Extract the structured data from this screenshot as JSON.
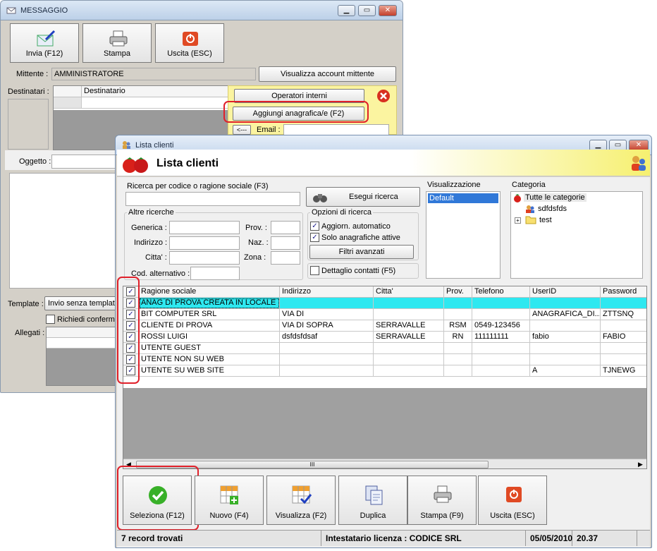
{
  "messaggio": {
    "title": "MESSAGGIO",
    "toolbar": {
      "send": "Invia (F12)",
      "print": "Stampa",
      "exit": "Uscita (ESC)"
    },
    "mittente_label": "Mittente :",
    "mittente_value": "AMMINISTRATORE",
    "view_account": "Visualizza account mittente",
    "destinatari_label": "Destinatari :",
    "destinatario_col": "Destinatario",
    "operatori_interni": "Operatori interni",
    "aggiungi_anagrafica": "Aggiungi anagrafica/e (F2)",
    "arrow_btn": "<---",
    "email_label": "Email :",
    "oggetto_label": "Oggetto :",
    "template_label": "Template :",
    "template_value": "Invio senza template",
    "richiedi_label": "Richiedi conferma",
    "allegati_label": "Allegati :"
  },
  "lista": {
    "title": "Lista clienti",
    "header": "Lista clienti",
    "search_label": "Ricerca per codice o ragione sociale (F3)",
    "search_button": "Esegui ricerca",
    "altre_ricerche": "Altre ricerche",
    "generica": "Generica :",
    "indirizzo": "Indirizzo :",
    "citta": "Citta' :",
    "cod_alt": "Cod. alternativo :",
    "prov": "Prov. :",
    "naz": "Naz. :",
    "zona": "Zona :",
    "opzioni": "Opzioni di ricerca",
    "aggiorn": "Aggiorn. automatico",
    "solo_attive": "Solo anagrafiche attive",
    "filtri": "Filtri avanzati",
    "dettaglio": "Dettaglio contatti (F5)",
    "visualizzazione": "Visualizzazione",
    "vis_default": "Default",
    "categoria": "Categoria",
    "categories": [
      "Tutte le categorie",
      "sdfdsfds",
      "test"
    ],
    "columns": [
      "Ragione sociale",
      "Indirizzo",
      "Citta'",
      "Prov.",
      "Telefono",
      "UserID",
      "Password"
    ],
    "rows": [
      [
        "ANAG DI PROVA CREATA IN LOCALE",
        "",
        "",
        "",
        "",
        "",
        ""
      ],
      [
        "BIT COMPUTER SRL",
        "VIA DI",
        "",
        "",
        "",
        "ANAGRAFICA_DI...",
        "ZTTSNQ"
      ],
      [
        "CLIENTE DI PROVA",
        "VIA DI SOPRA",
        "SERRAVALLE",
        "RSM",
        "0549-123456",
        "",
        ""
      ],
      [
        "ROSSI LUIGI",
        "dsfdsfdsaf",
        "SERRAVALLE",
        "RN",
        "111111111",
        "fabio",
        "FABIO"
      ],
      [
        "UTENTE GUEST",
        "",
        "",
        "",
        "",
        "",
        ""
      ],
      [
        "UTENTE NON SU WEB",
        "",
        "",
        "",
        "",
        "",
        ""
      ],
      [
        "UTENTE SU WEB SITE",
        "",
        "",
        "",
        "",
        "A",
        "TJNEWG"
      ]
    ],
    "buttons": {
      "seleziona": "Seleziona (F12)",
      "nuovo": "Nuovo (F4)",
      "visualizza": "Visualizza (F2)",
      "duplica": "Duplica",
      "stampa": "Stampa (F9)",
      "uscita": "Uscita (ESC)"
    },
    "status": {
      "records": "7 record trovati",
      "licenza": "Intestatario licenza : CODICE SRL",
      "date": "05/05/2010",
      "time": "20.37"
    },
    "scroll_mark": "III"
  },
  "colors": {
    "highlight_row": "#2ee8f0",
    "yellow_panel": "#fbf4a0",
    "red_annotation": "#e0202a"
  }
}
